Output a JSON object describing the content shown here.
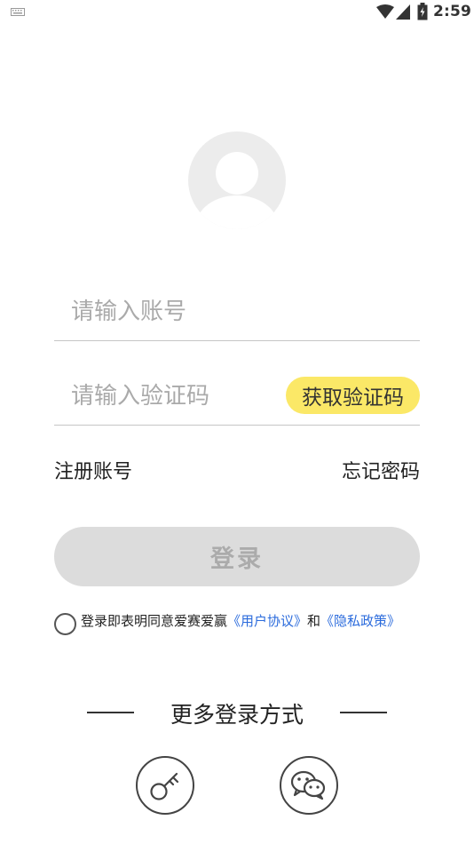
{
  "status_bar": {
    "time": "2:59",
    "icons": [
      "keyboard-icon",
      "wifi-icon",
      "signal-icon",
      "battery-icon"
    ]
  },
  "login_form": {
    "account_placeholder": "请输入账号",
    "code_placeholder": "请输入验证码",
    "get_code_label": "获取验证码",
    "register_link": "注册账号",
    "forgot_link": "忘记密码",
    "login_button": "登录"
  },
  "agreement": {
    "prefix": "登录即表明同意爱赛爱赢",
    "user_agreement": "《用户协议》",
    "connector": "和",
    "privacy_policy": "《隐私政策》",
    "checked": false
  },
  "more_login": {
    "title": "更多登录方式",
    "options": [
      "key-login-icon",
      "wechat-icon"
    ]
  },
  "colors": {
    "code_button": "#fbe867",
    "login_button": "#dcdcdc",
    "link_blue": "#2b6bdc"
  }
}
